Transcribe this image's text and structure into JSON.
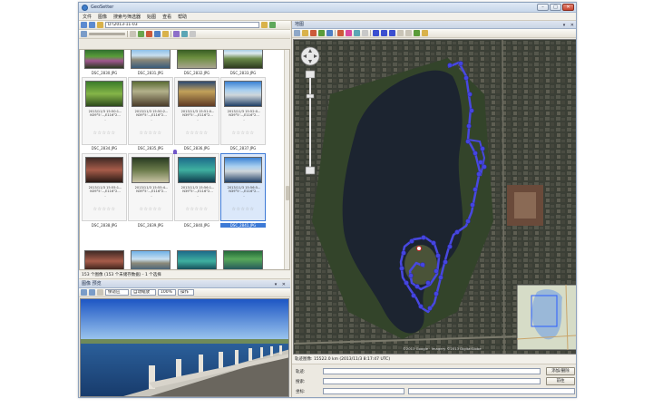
{
  "app": {
    "title": "GeoSetter"
  },
  "window_buttons": {
    "minimize": "–",
    "maximize": "□",
    "close": "✕"
  },
  "menu": [
    "文件",
    "图像",
    "搜索与筛选器",
    "始图",
    "查看",
    "帮助"
  ],
  "path_bar": {
    "value": "D:\\2013-11-03"
  },
  "filenames_row1": [
    "DSC_2830.JPG",
    "DSC_2831.JPG",
    "DSC_2832.JPG",
    "DSC_2833.JPG"
  ],
  "thumbnails": [
    {
      "name": "DSC_2834.JPG",
      "meta": [
        "2013/11/3 15:50:1...",
        "N39°5'...,E116°2...",
        "-"
      ],
      "stars": "☆☆☆☆☆"
    },
    {
      "name": "DSC_2835.JPG",
      "meta": [
        "2013/11/3 15:50:2...",
        "N39°5'...,E116°2...",
        "-"
      ],
      "stars": "☆☆☆☆☆"
    },
    {
      "name": "DSC_2836.JPG",
      "meta": [
        "2013/11/3 15:51:0...",
        "N39°5'...,E116°2...",
        "-"
      ],
      "stars": "☆☆☆☆☆"
    },
    {
      "name": "DSC_2837.JPG",
      "meta": [
        "2013/11/3 15:52:0...",
        "N39°5'...,E116°2...",
        "-"
      ],
      "stars": "☆☆☆☆☆"
    },
    {
      "name": "DSC_2838.JPG",
      "meta": [
        "2013/11/3 15:55:1...",
        "N39°5'...,E116°2...",
        "-"
      ],
      "stars": "☆☆☆☆☆"
    },
    {
      "name": "DSC_2839.JPG",
      "meta": [
        "2013/11/3 15:55:4...",
        "N39°5'...,E116°2...",
        "-"
      ],
      "stars": "☆☆☆☆☆"
    },
    {
      "name": "DSC_2840.JPG",
      "meta": [
        "2013/11/3 15:56:1...",
        "N39°5'...,E116°2...",
        "-"
      ],
      "stars": "☆☆☆☆☆"
    },
    {
      "name": "DSC_2841.JPG",
      "meta": [
        "2013/11/3 15:56:5...",
        "N39°5'...,E116°2...",
        "-"
      ],
      "stars": "☆☆☆☆☆"
    }
  ],
  "filenames_row2": [
    "DSC_2834.JPG",
    "DSC_2835.JPG",
    "DSC_2836.JPG",
    "DSC_2837.JPG"
  ],
  "filenames_row3": [
    "DSC_2838.JPG",
    "DSC_2839.JPG",
    "DSC_2840.JPG",
    "DSC_2841.JPG"
  ],
  "selected_index": 7,
  "status_left": "153 个图像 (153 个未储存数据) - 1 个选择",
  "preview": {
    "header": "图像 预览",
    "fit_label": "保适应",
    "auto_label": "自动缩放",
    "zoom": "100%",
    "extra": "操作"
  },
  "map": {
    "header": "地图",
    "copyright": "©2013 Google · Imagery ©2013 DigitalGlobe",
    "status": "轨迹图像: 15522.0 km (2013/11/3 8:17:47 UTC)"
  },
  "form": {
    "row1_label": "轨迹:",
    "row1_button": "添加/删除",
    "row2_label": "搜索:",
    "row2_button": "前往",
    "row3_label": "坐标:"
  },
  "colors": {
    "track": "#4848e0",
    "water": "#1c2430",
    "accent": "#3d7ad6"
  }
}
